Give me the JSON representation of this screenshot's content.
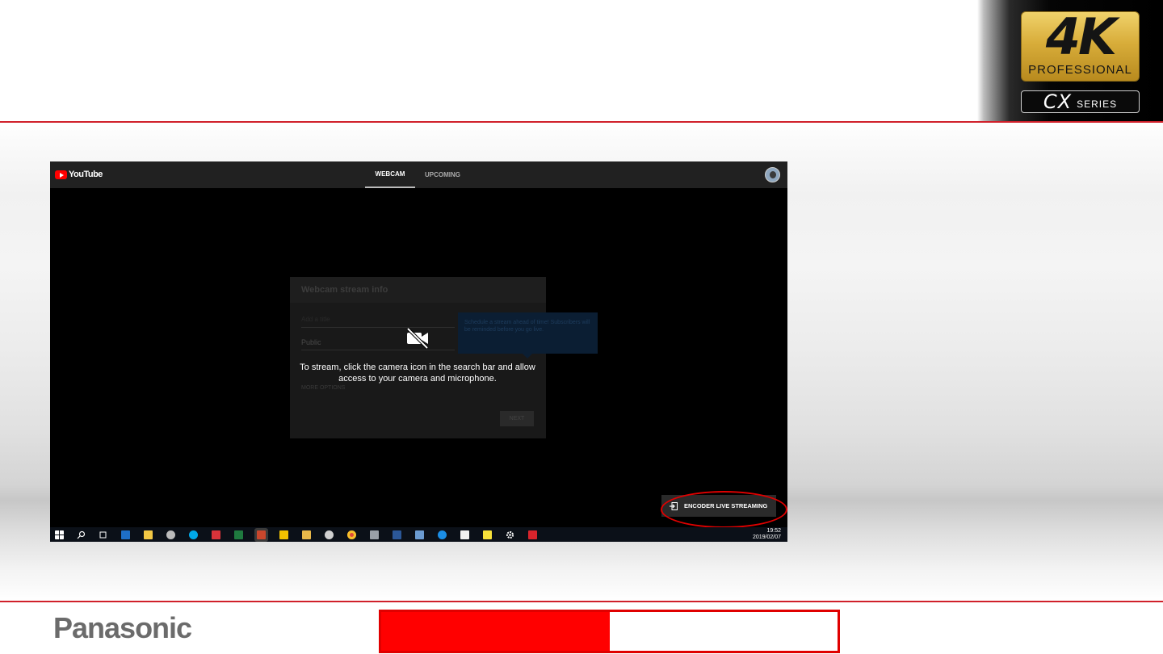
{
  "slide": {
    "badge_4k": "4K",
    "badge_professional": "PROFESSIONAL",
    "badge_cx": "CX",
    "badge_series": "SERIES",
    "brand": "Panasonic",
    "accent_color": "#d0202a"
  },
  "youtube": {
    "logo_text": "YouTube",
    "tabs": [
      {
        "label": "WEBCAM",
        "active": true
      },
      {
        "label": "UPCOMING",
        "active": false
      }
    ],
    "dialog": {
      "title": "Webcam stream info",
      "title_field": "Add a title",
      "privacy": "Public",
      "more_options": "MORE OPTIONS",
      "next_button": "NEXT"
    },
    "tooltip": "Schedule a stream ahead of time! Subscribers will be reminded before you go live.",
    "message": "To stream, click the camera icon in the search bar and allow access to your camera and microphone.",
    "encoder_button": "ENCODER LIVE STREAMING"
  },
  "taskbar": {
    "time": "19:52",
    "date": "2019/02/07"
  }
}
